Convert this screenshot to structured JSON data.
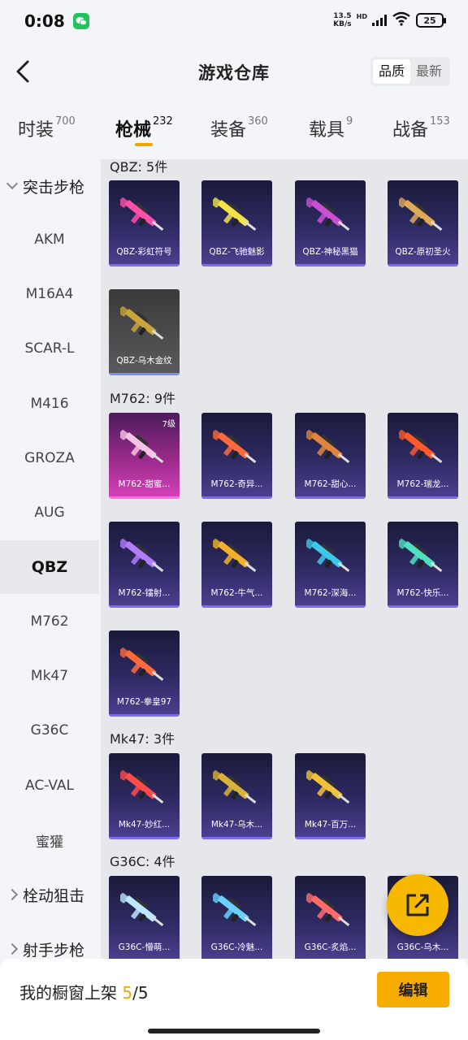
{
  "status_bar": {
    "time": "0:08",
    "net_speed_value": "13.5",
    "net_speed_unit": "KB/s",
    "hd": "HD",
    "battery": "25"
  },
  "header": {
    "title": "游戏仓库",
    "sort_options": [
      "品质",
      "最新"
    ],
    "active_sort": "品质"
  },
  "tabs": [
    {
      "label": "时装",
      "count": "700"
    },
    {
      "label": "枪械",
      "count": "232",
      "active": true
    },
    {
      "label": "装备",
      "count": "360"
    },
    {
      "label": "载具",
      "count": "9"
    },
    {
      "label": "战备",
      "count": "153"
    }
  ],
  "sidebar": {
    "group_assault": "突击步枪",
    "items": [
      "AKM",
      "M16A4",
      "SCAR-L",
      "M416",
      "GROZA",
      "AUG",
      "QBZ",
      "M762",
      "Mk47",
      "G36C",
      "AC-VAL",
      "蜜獾"
    ],
    "active_item": "QBZ",
    "group_bolt": "栓动狙击",
    "group_marksman": "射手步枪"
  },
  "sections": [
    {
      "title": "QBZ: 5件",
      "items": [
        {
          "label": "QBZ-彩虹符号",
          "color": "#ff4fa8"
        },
        {
          "label": "QBZ-飞驰魅影",
          "color": "#f3e24a"
        },
        {
          "label": "QBZ-神秘黑猫",
          "color": "#c94fd3"
        },
        {
          "label": "QBZ-原初圣火",
          "color": "#e0a95a"
        },
        {
          "label": "QBZ-乌木金纹",
          "color": "#c9a43a"
        }
      ]
    },
    {
      "title": "M762: 9件",
      "items": [
        {
          "label": "M762-甜蜜...",
          "color": "#f7c4e6",
          "level": "7级"
        },
        {
          "label": "M762-奇异...",
          "color": "#ff6a3c"
        },
        {
          "label": "M762-甜心...",
          "color": "#e0863c"
        },
        {
          "label": "M762-瑞龙...",
          "color": "#ff5a2a"
        },
        {
          "label": "M762-镭射...",
          "color": "#b27cff"
        },
        {
          "label": "M762-牛气...",
          "color": "#f2b12a"
        },
        {
          "label": "M762-深海...",
          "color": "#3ec7e6"
        },
        {
          "label": "M762-快乐...",
          "color": "#4fe0c0"
        },
        {
          "label": "M762-拳皇97",
          "color": "#ff6a3c"
        }
      ]
    },
    {
      "title": "Mk47: 3件",
      "items": [
        {
          "label": "Mk47-妙红...",
          "color": "#ff4b4b"
        },
        {
          "label": "Mk47-乌木...",
          "color": "#d9b23a"
        },
        {
          "label": "Mk47-百万...",
          "color": "#f0c23a"
        }
      ]
    },
    {
      "title": "G36C: 4件",
      "items": [
        {
          "label": "G36C-懵萌...",
          "color": "#bde6ff"
        },
        {
          "label": "G36C-冷魅...",
          "color": "#6ad0ff"
        },
        {
          "label": "G36C-炙焰...",
          "color": "#ff6b6b"
        },
        {
          "label": "G36C-乌木...",
          "color": "#d9b23a"
        }
      ]
    }
  ],
  "bottom": {
    "showcase_label": "我的橱窗上架",
    "showcase_current": "5",
    "showcase_total": "/5",
    "edit_label": "编辑"
  }
}
